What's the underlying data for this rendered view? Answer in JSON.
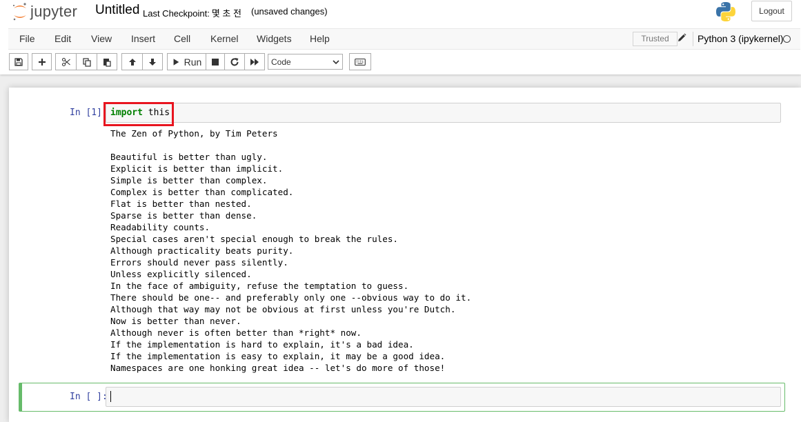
{
  "header": {
    "logo_text": "jupyter",
    "notebook_name": "Untitled",
    "checkpoint_label": "Last Checkpoint:",
    "checkpoint_time": "몇 초 전",
    "unsaved": "(unsaved changes)",
    "logout": "Logout"
  },
  "menu": {
    "items": [
      "File",
      "Edit",
      "View",
      "Insert",
      "Cell",
      "Kernel",
      "Widgets",
      "Help"
    ],
    "trusted": "Trusted",
    "kernel_name": "Python 3 (ipykernel)"
  },
  "toolbar": {
    "run_label": "Run",
    "cell_type": "Code",
    "cell_type_options": [
      "Code"
    ]
  },
  "cells": [
    {
      "prompt": "In [1]:",
      "code_keyword": "import",
      "code_rest": " this",
      "output": [
        "The Zen of Python, by Tim Peters",
        "",
        "Beautiful is better than ugly.",
        "Explicit is better than implicit.",
        "Simple is better than complex.",
        "Complex is better than complicated.",
        "Flat is better than nested.",
        "Sparse is better than dense.",
        "Readability counts.",
        "Special cases aren't special enough to break the rules.",
        "Although practicality beats purity.",
        "Errors should never pass silently.",
        "Unless explicitly silenced.",
        "In the face of ambiguity, refuse the temptation to guess.",
        "There should be one-- and preferably only one --obvious way to do it.",
        "Although that way may not be obvious at first unless you're Dutch.",
        "Now is better than never.",
        "Although never is often better than *right* now.",
        "If the implementation is hard to explain, it's a bad idea.",
        "If the implementation is easy to explain, it may be a good idea.",
        "Namespaces are one honking great idea -- let's do more of those!"
      ]
    },
    {
      "prompt": "In [ ]:",
      "code": ""
    }
  ],
  "colors": {
    "prompt": "#303f9f",
    "keyword": "#008000",
    "selected_border": "#66bb6a",
    "highlight_box": "#e8141f",
    "logo_orange": "#f37726"
  }
}
